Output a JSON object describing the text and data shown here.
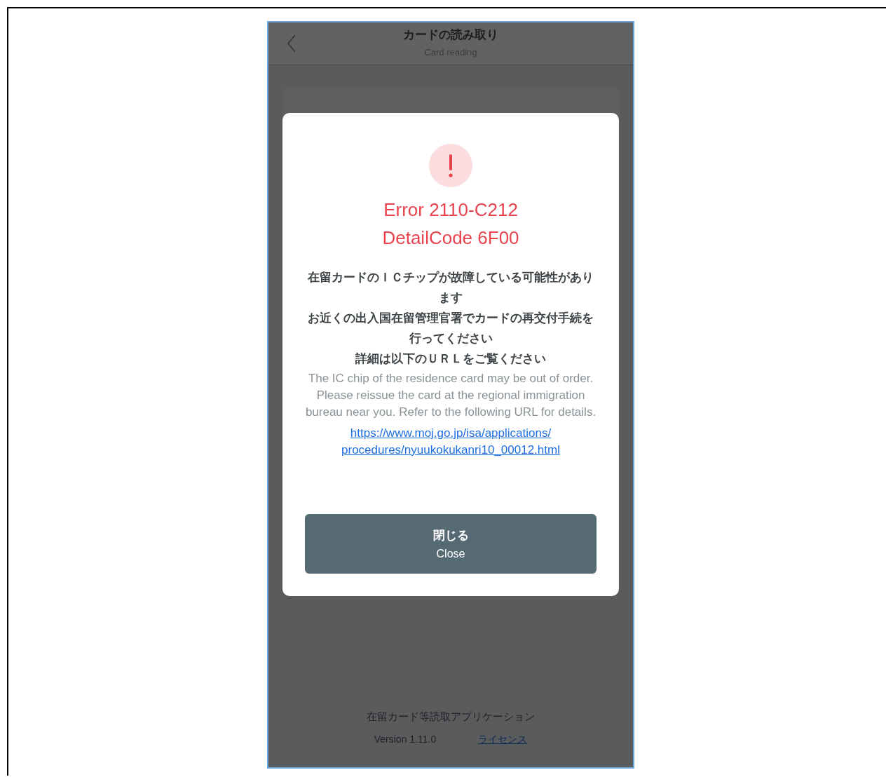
{
  "header": {
    "title": "カードの読み取り",
    "subtitle": "Card reading"
  },
  "dialog": {
    "error_lines": [
      "Error 2110-C212",
      "DetailCode 6F00"
    ],
    "message_ja": [
      "在留カードのＩＣチップが故障している可能性があります",
      "お近くの出入国在留管理官署でカードの再交付手続を行ってください",
      "詳細は以下のＵＲＬをご覧ください"
    ],
    "message_en": "The IC chip of the residence card may be out of order. Please reissue the card at the regional immigration bureau near you. Refer to the following URL for details.",
    "link": "https://www.moj.go.jp/isa/applications/procedures/nyuukokukanri10_00012.html",
    "button": {
      "label": "閉じる",
      "sublabel": "Close"
    }
  },
  "footer": {
    "app_name": "在留カード等読取アプリケーション",
    "version": "Version 1.11.0",
    "license_link": "ライセンス"
  }
}
